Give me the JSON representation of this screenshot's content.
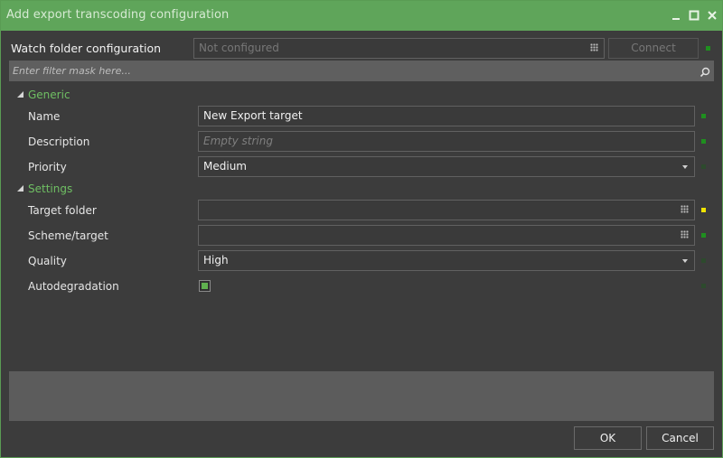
{
  "window": {
    "title": "Add export transcoding configuration",
    "controls": [
      "minimize-icon",
      "maximize-icon",
      "close-icon"
    ]
  },
  "watch_folder": {
    "label": "Watch folder configuration",
    "value": "Not configured",
    "connect_label": "Connect"
  },
  "filter": {
    "placeholder": "Enter filter mask here..."
  },
  "sections": {
    "generic": "Generic",
    "settings": "Settings"
  },
  "fields": {
    "name": {
      "label": "Name",
      "value": "New Export target"
    },
    "description": {
      "label": "Description",
      "placeholder": "Empty string"
    },
    "priority": {
      "label": "Priority",
      "value": "Medium"
    },
    "target_folder": {
      "label": "Target folder",
      "value": ""
    },
    "scheme_target": {
      "label": "Scheme/target",
      "value": ""
    },
    "quality": {
      "label": "Quality",
      "value": "High"
    },
    "autodegradation": {
      "label": "Autodegradation",
      "checked": true
    }
  },
  "buttons": {
    "ok": "OK",
    "cancel": "Cancel"
  },
  "colors": {
    "accent": "#5fa55a",
    "section_text": "#6fbf63",
    "status_ok": "#1f8f1f",
    "status_warning": "#f0e400"
  }
}
